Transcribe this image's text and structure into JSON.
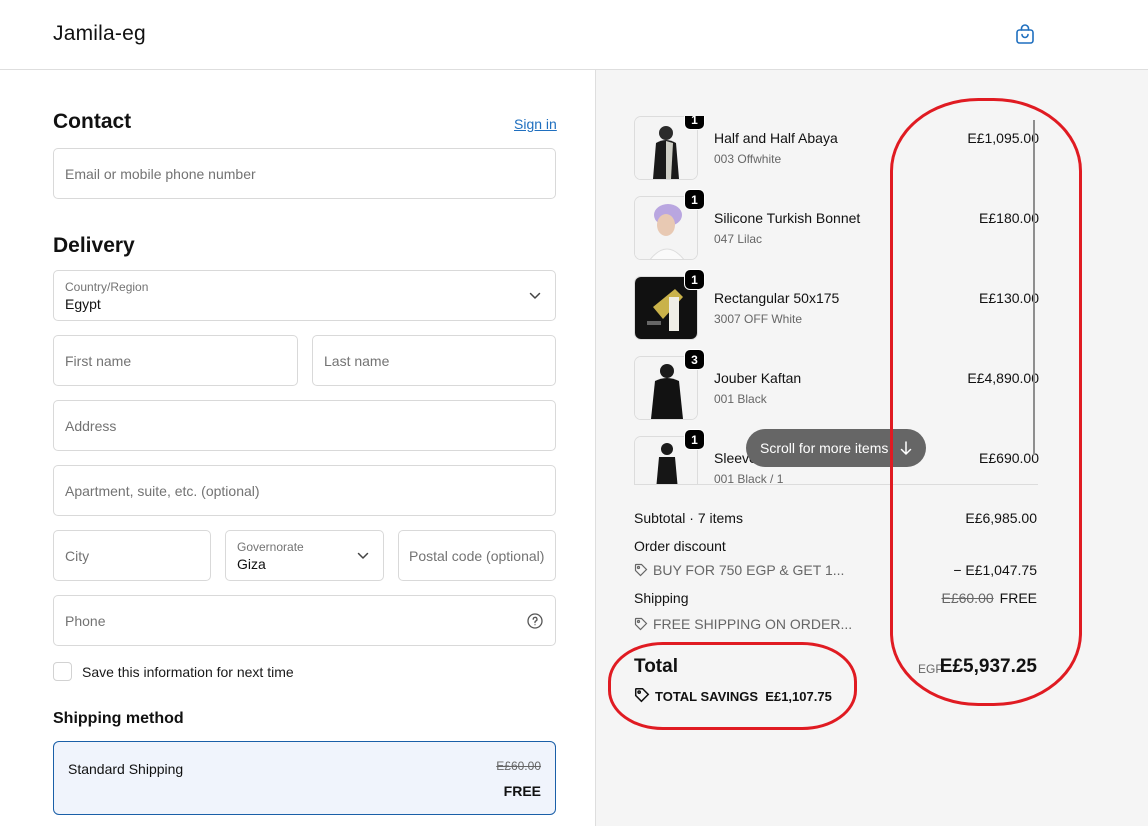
{
  "header": {
    "brand": "Jamila-eg",
    "bag_icon": "shopping-bag-icon"
  },
  "contact": {
    "title": "Contact",
    "sign_in": "Sign in",
    "email_placeholder": "Email or mobile phone number"
  },
  "delivery": {
    "title": "Delivery",
    "country_label": "Country/Region",
    "country_value": "Egypt",
    "first_name": "First name",
    "last_name": "Last name",
    "address": "Address",
    "apartment": "Apartment, suite, etc. (optional)",
    "city": "City",
    "governorate_label": "Governorate",
    "governorate_value": "Giza",
    "postal": "Postal code (optional)",
    "phone": "Phone",
    "save_info": "Save this information for next time"
  },
  "shipping_method": {
    "title": "Shipping method",
    "name": "Standard Shipping",
    "old_price": "E£60.00",
    "price": "FREE"
  },
  "summary": {
    "items": [
      {
        "qty": "1",
        "name": "Half and Half Abaya",
        "variant": "003 Offwhite",
        "price": "E£1,095.00"
      },
      {
        "qty": "1",
        "name": "Silicone Turkish Bonnet",
        "variant": "047 Lilac",
        "price": "E£180.00"
      },
      {
        "qty": "1",
        "name": "Rectangular 50x175",
        "variant": "3007 OFF White",
        "price": "E£130.00"
      },
      {
        "qty": "3",
        "name": "Jouber Kaftan",
        "variant": "001 Black",
        "price": "E£4,890.00"
      },
      {
        "qty": "1",
        "name": "Sleeve",
        "variant": "001 Black / 1",
        "price": "E£690.00"
      }
    ],
    "scroll_hint": "Scroll for more items",
    "subtotal_label": "Subtotal · 7 items",
    "subtotal_value": "E£6,985.00",
    "discount_label": "Order discount",
    "discount_code": "BUY FOR 750 EGP & GET 1...",
    "discount_value": "− E£1,047.75",
    "shipping_label": "Shipping",
    "shipping_old": "E£60.00",
    "shipping_value": "FREE",
    "shipping_code": "FREE SHIPPING ON ORDER...",
    "total_label": "Total",
    "total_currency": "EGP",
    "total_value": "E£5,937.25",
    "savings_label": "TOTAL SAVINGS",
    "savings_value": "E£1,107.75"
  },
  "colors": {
    "accent": "#1f6fbf",
    "annotation": "#e01b22",
    "summary_bg": "#f5f5f5"
  }
}
